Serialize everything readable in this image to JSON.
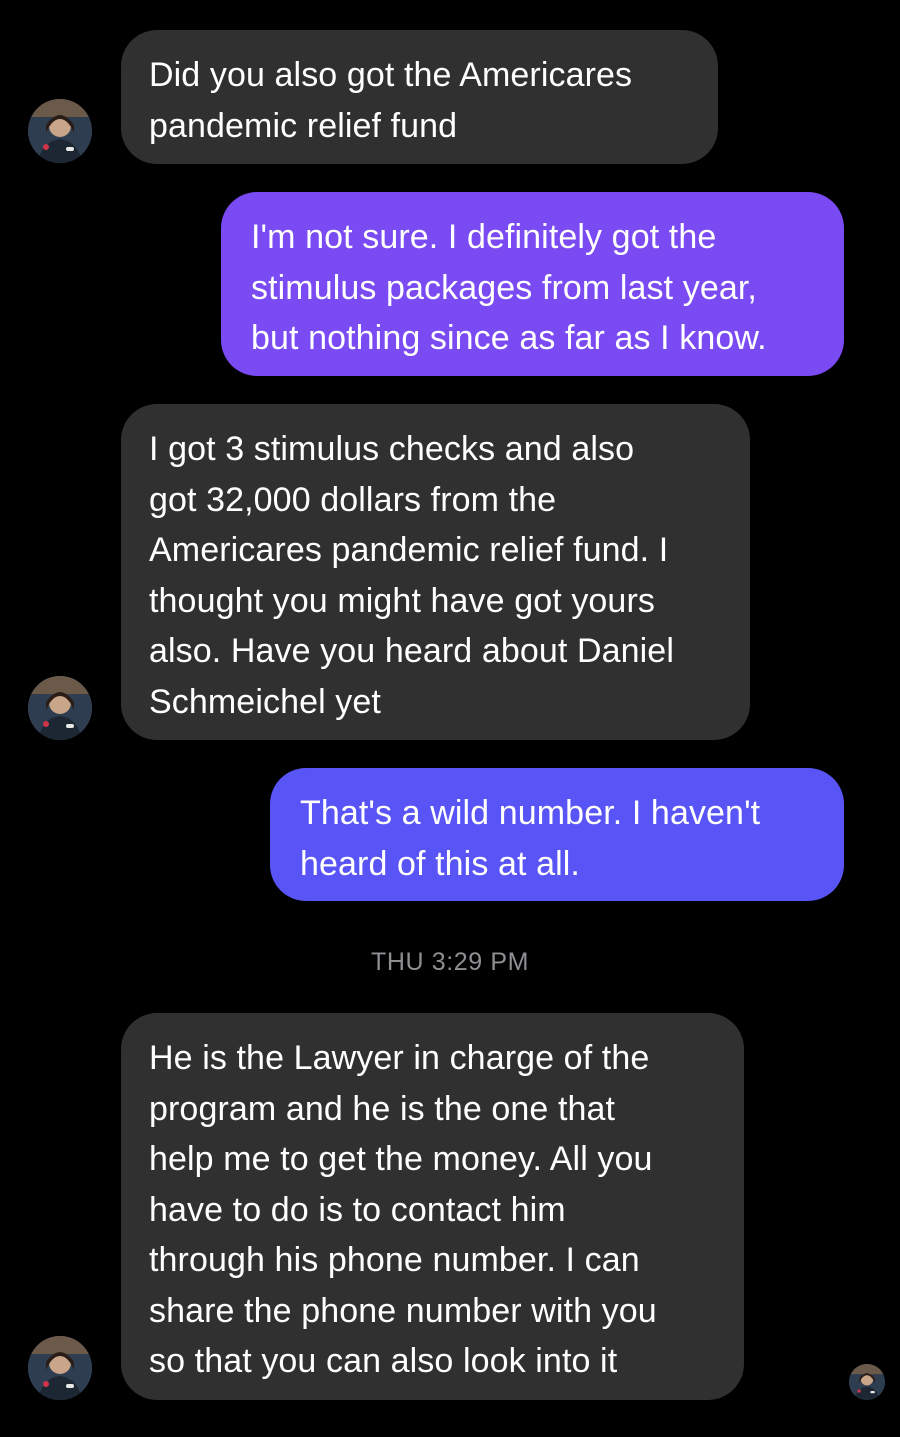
{
  "thread": {
    "timestamp": "THU 3:29 PM",
    "messages": [
      {
        "sender": "contact",
        "text": "Did you also got the Americares\npandemic relief fund"
      },
      {
        "sender": "me",
        "text": "I'm not sure. I definitely got the\nstimulus packages from last year,\nbut nothing since as far as I know."
      },
      {
        "sender": "contact",
        "text": "I got 3 stimulus checks and also\ngot 32,000 dollars from the\nAmericares pandemic relief fund. I\nthought you might have got yours\nalso. Have you heard about Daniel\nSchmeichel yet"
      },
      {
        "sender": "me",
        "text": "That's a wild number. I haven't\nheard of this at all."
      },
      {
        "sender": "contact",
        "text": "He is the Lawyer in charge of the\nprogram and he is the one that\nhelp me to get the money. All you\nhave to do is to contact him\nthrough his phone number. I can\nshare the phone number with you\nso that you can also look into it"
      }
    ]
  },
  "colors": {
    "background": "#000000",
    "incoming_bubble": "#303030",
    "outgoing_bubble_top": "#7a4af2",
    "outgoing_bubble_bottom": "#5954f5",
    "timestamp_text": "#8e8e93"
  },
  "icons": {
    "contact_avatar": "contact-avatar-photo",
    "seen_indicator": "seen-avatar-photo"
  }
}
